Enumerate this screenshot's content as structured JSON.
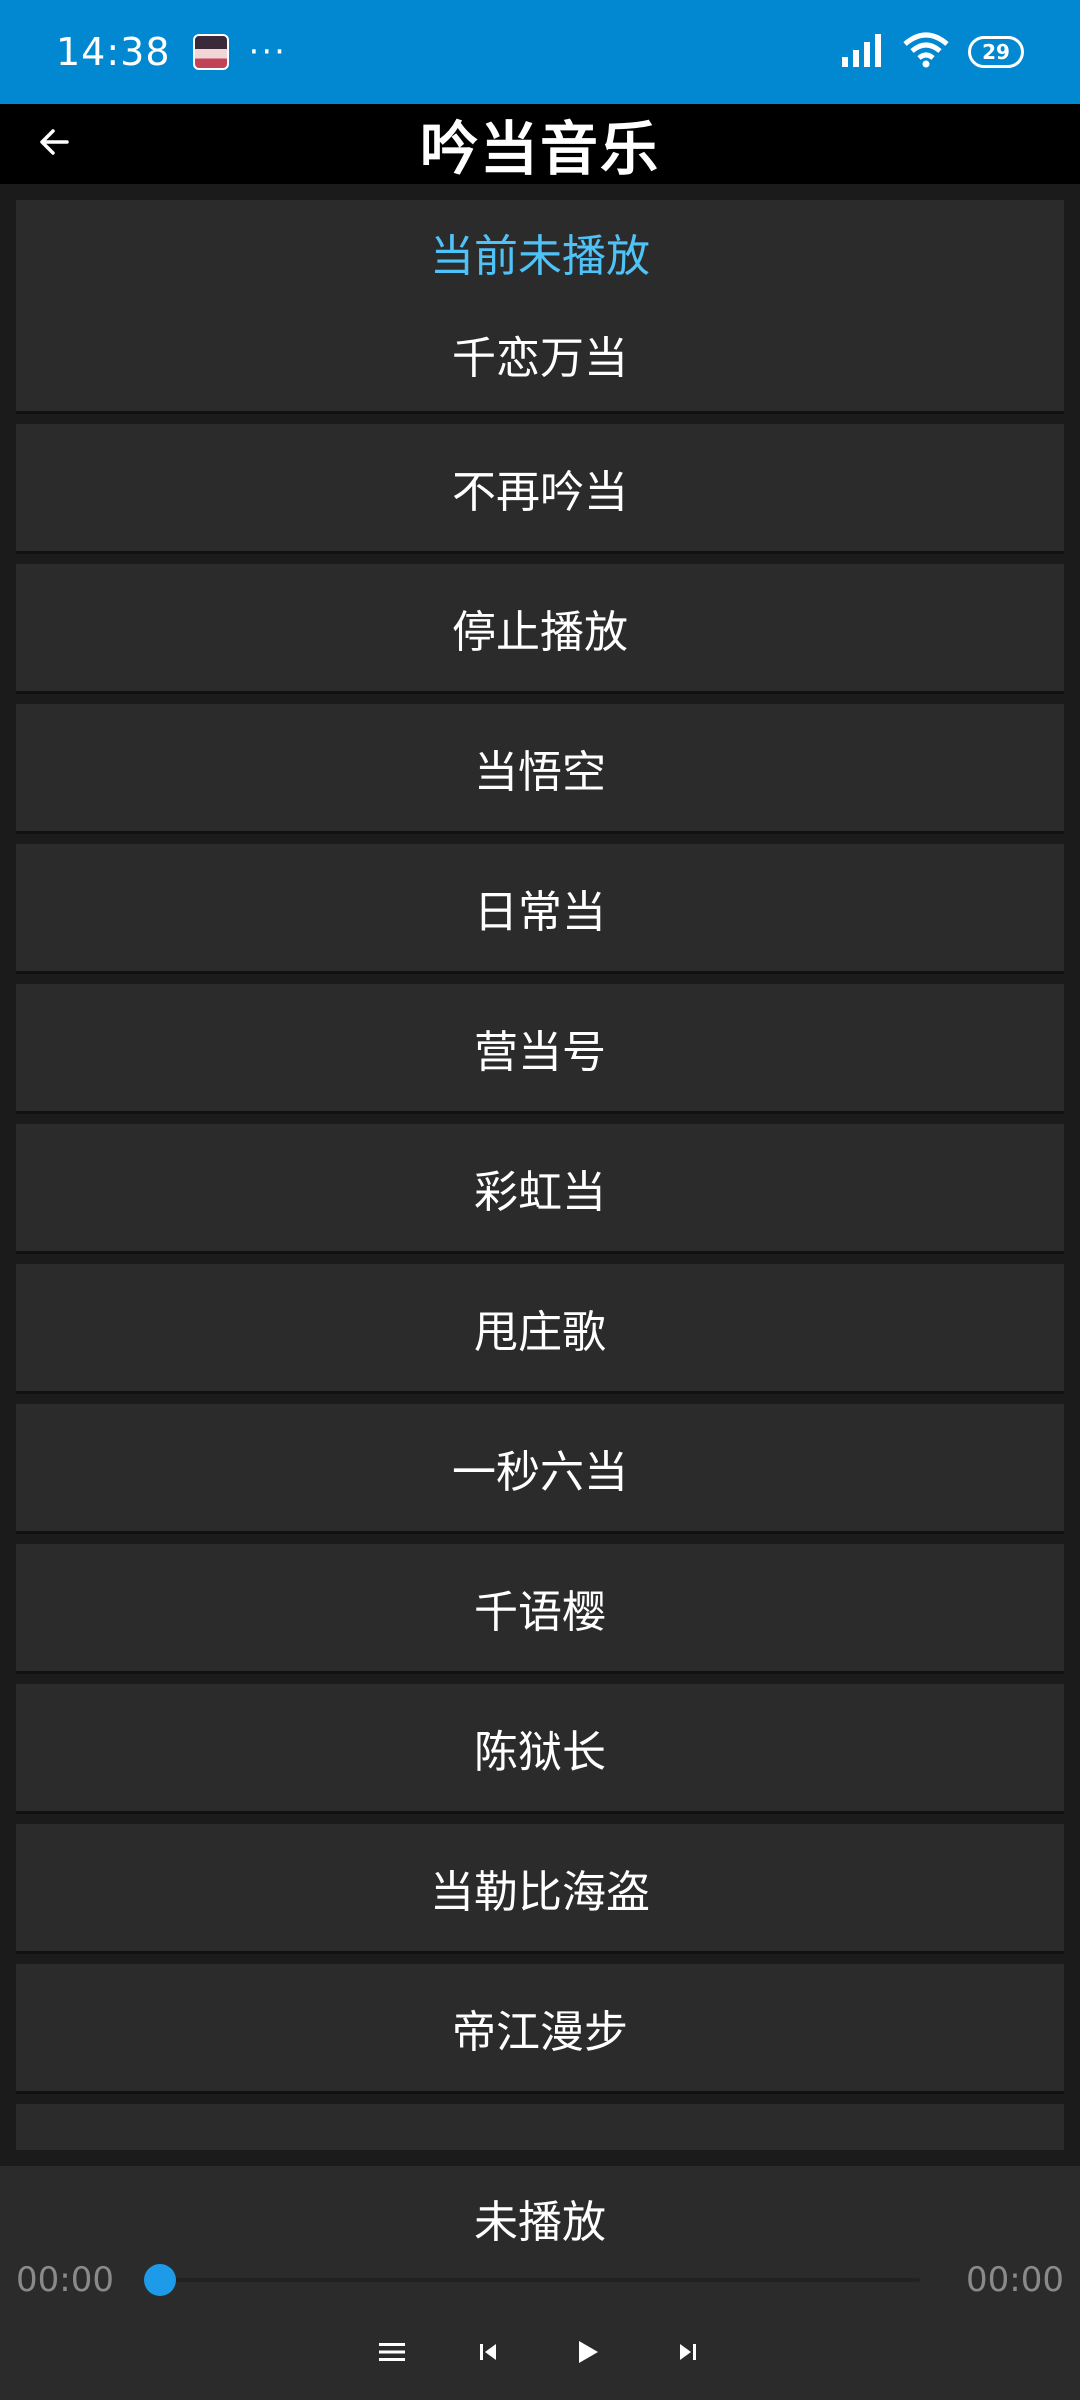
{
  "status_bar": {
    "time": "14:38",
    "more": "···",
    "battery": "29"
  },
  "header": {
    "title": "吟当音乐"
  },
  "now_playing_card": {
    "status": "当前未播放",
    "first_song": "千恋万当"
  },
  "songs": [
    "不再吟当",
    "停止播放",
    "当悟空",
    "日常当",
    "营当号",
    "彩虹当",
    "甩庄歌",
    "一秒六当",
    "千语樱",
    "陈狱长",
    "当勒比海盗",
    "帝江漫步",
    ""
  ],
  "player": {
    "song": "未播放",
    "current_time": "00:00",
    "total_time": "00:00",
    "progress": 0
  },
  "colors": {
    "status_bar": "#0288d1",
    "accent_text": "#4fc3f7",
    "seek_thumb": "#1e9be8"
  }
}
